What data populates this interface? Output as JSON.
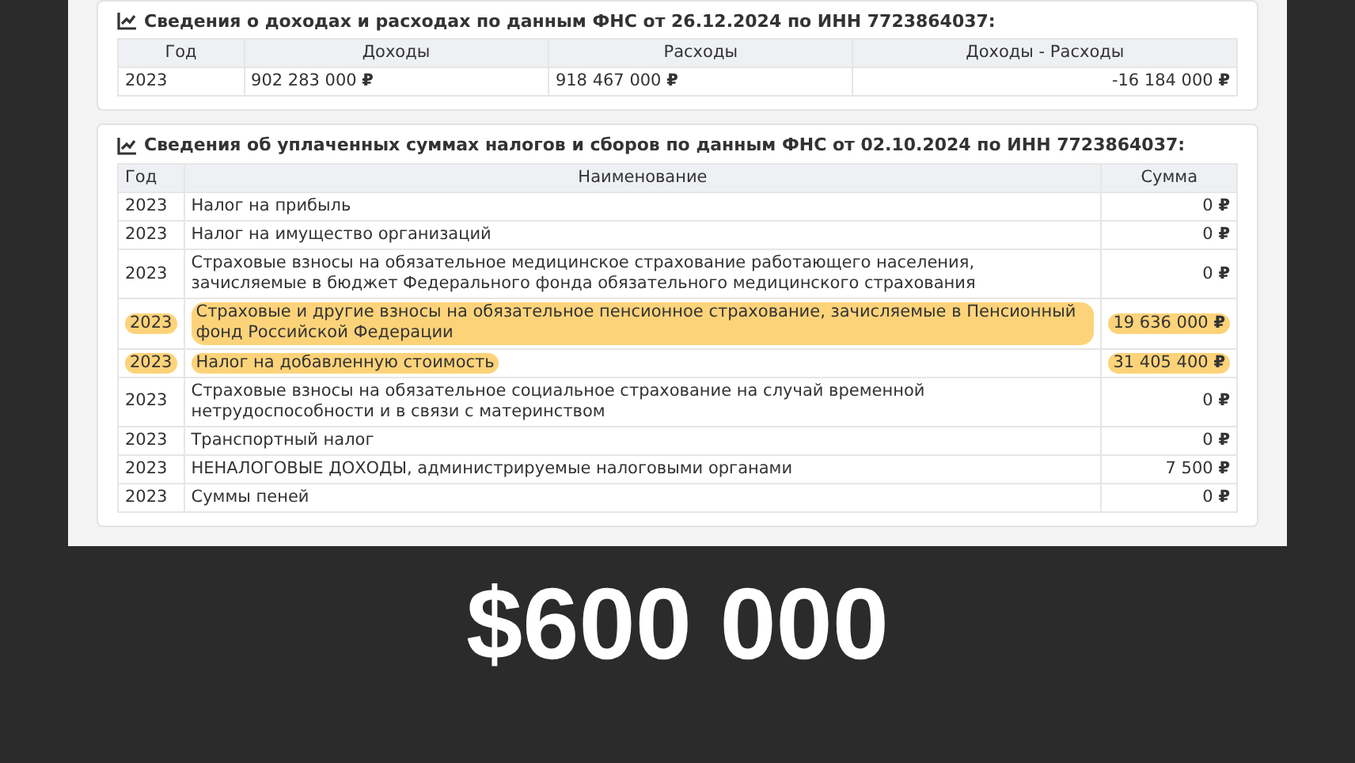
{
  "income_section": {
    "title": "Сведения о доходах и расходах по данным ФНС от 26.12.2024 по ИНН 7723864037:",
    "columns": [
      "Год",
      "Доходы",
      "Расходы",
      "Доходы - Расходы"
    ],
    "rows": [
      {
        "year": "2023",
        "income": "902 283 000 **₽**",
        "expenses": "918 467 000 **₽**",
        "balance": "-16 184 000 **₽**"
      }
    ]
  },
  "tax_section": {
    "title": "Сведения об уплаченных суммах налогов и сборов по данным ФНС от 02.10.2024 по ИНН 7723864037:",
    "columns": [
      "Год",
      "Наименование",
      "Сумма"
    ],
    "rows": [
      {
        "year": "2023",
        "name": "Налог на прибыль",
        "amount": "0 **₽**",
        "highlighted": false
      },
      {
        "year": "2023",
        "name": "Налог на имущество организаций",
        "amount": "0 **₽**",
        "highlighted": false
      },
      {
        "year": "2023",
        "name": "Страховые взносы на обязательное медицинское страхование работающего населения, зачисляемые в бюджет Федерального фонда обязательного медицинского страхования",
        "amount": "0 **₽**",
        "highlighted": false
      },
      {
        "year": "2023",
        "name": "Страховые и другие взносы на обязательное пенсионное страхование, зачисляемые в Пенсионный фонд Российской Федерации",
        "amount": "19 636 000 **₽**",
        "highlighted": true
      },
      {
        "year": "2023",
        "name": "Налог на добавленную стоимость",
        "amount": "31 405 400 **₽**",
        "highlighted": true
      },
      {
        "year": "2023",
        "name": "Страховые взносы на обязательное социальное страхование на случай временной нетрудоспособности и в связи с материнством",
        "amount": "0 **₽**",
        "highlighted": false
      },
      {
        "year": "2023",
        "name": "Транспортный налог",
        "amount": "0 **₽**",
        "highlighted": false
      },
      {
        "year": "2023",
        "name": "НЕНАЛОГОВЫЕ ДОХОДЫ, администрируемые налоговыми органами",
        "amount": "7 500 **₽**",
        "highlighted": false
      },
      {
        "year": "2023",
        "name": "Суммы пеней",
        "amount": "0 **₽**",
        "highlighted": false
      }
    ]
  },
  "caption": "$600 000"
}
